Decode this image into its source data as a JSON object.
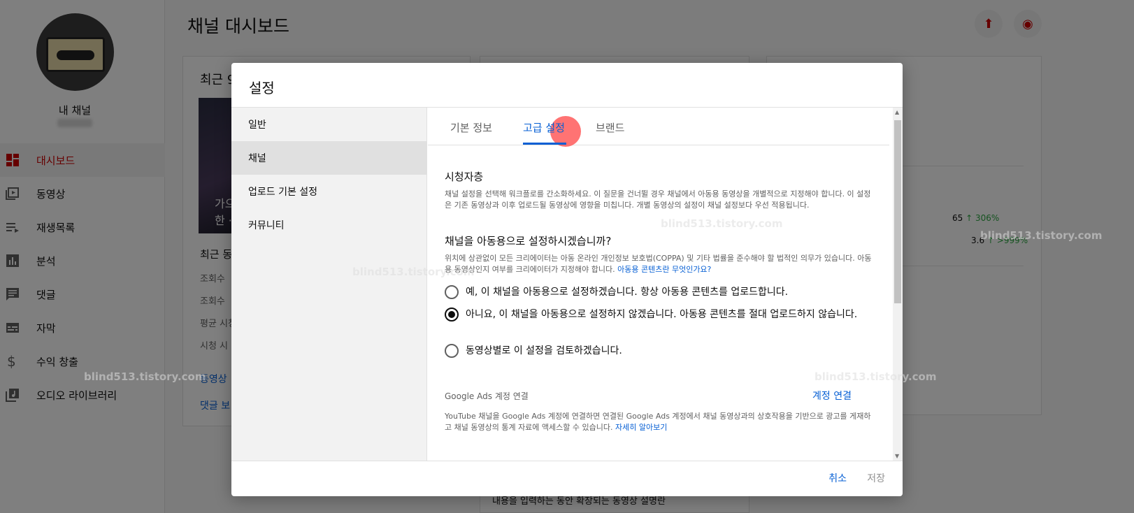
{
  "background": {
    "channel_name": "내 채널",
    "page_title": "채널 대시보드",
    "nav_items": [
      "대시보드",
      "동영상",
      "재생목록",
      "분석",
      "댓글",
      "자막",
      "수익 창출",
      "오디오 라이브러리"
    ],
    "card1_title": "최근 9",
    "thumb_text_1": "가으",
    "thumb_text_2": "한 ·",
    "recent_label": "최근 동",
    "stat_rows": [
      "조회수 ",
      "조회수 ",
      "평균 시청",
      "시청 시"
    ],
    "link_video": "동영상",
    "link_comments": "댓글 보",
    "stat1_value": "65",
    "stat1_change": "306%",
    "stat2_value": "3.6",
    "stat2_change": ">999%",
    "bottom_text": "내용을 입력하는 동안 확장되는 동영상 설명란"
  },
  "watermark": "blind513.tistory.com",
  "dialog": {
    "title": "설정",
    "nav_items": [
      "일반",
      "채널",
      "업로드 기본 설정",
      "커뮤니티"
    ],
    "tabs": [
      "기본 정보",
      "고급 설정",
      "브랜드"
    ],
    "audience_title": "시청자층",
    "audience_desc": "채널 설정을 선택해 워크플로를 간소화하세요. 이 질문을 건너뛸 경우 채널에서 아동용 동영상을 개별적으로 지정해야 합니다. 이 설정은 기존 동영상과 이후 업로드될 동영상에 영향을 미칩니다. 개별 동영상의 설정이 채널 설정보다 우선 적용됩니다.",
    "question": "채널을 아동용으로 설정하시겠습니까?",
    "coppa_desc": "위치에 상관없이 모든 크리에이터는 아동 온라인 개인정보 보호법(COPPA) 및 기타 법률을 준수해야 할 법적인 의무가 있습니다. 아동용 동영상인지 여부를 크리에이터가 지정해야 합니다.",
    "coppa_link": "아동용 콘텐츠란 무엇인가요?",
    "options": [
      "예, 이 채널을 아동용으로 설정하겠습니다. 항상 아동용 콘텐츠를 업로드합니다.",
      "아니요, 이 채널을 아동용으로 설정하지 않겠습니다. 아동용 콘텐츠를 절대 업로드하지 않습니다.",
      "동영상별로 이 설정을 검토하겠습니다."
    ],
    "selected_option_index": 1,
    "ads_title": "Google Ads 계정 연결",
    "ads_link": "계정 연결",
    "ads_desc": "YouTube 채널을 Google Ads 계정에 연결하면 연결된 Google Ads 계정에서 채널 동영상과의 상호작용을 기반으로 광고를 게재하고 채널 동영상의 통계 자료에 액세스할 수 있습니다.",
    "ads_more": "자세히 알아보기",
    "cancel": "취소",
    "save": "저장"
  },
  "colors": {
    "accent": "#065fd4",
    "brand_red": "#cc0000",
    "positive": "#2ba640"
  }
}
